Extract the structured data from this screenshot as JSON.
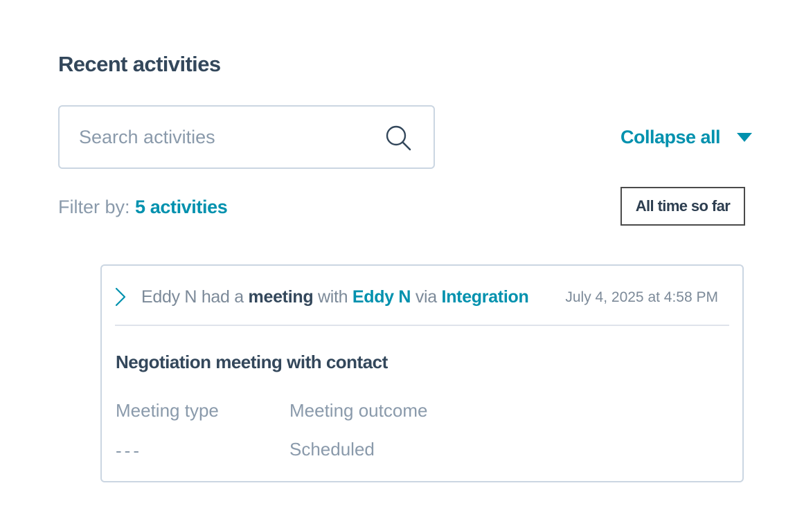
{
  "header": {
    "title": "Recent activities"
  },
  "search": {
    "placeholder": "Search activities",
    "value": ""
  },
  "toolbar": {
    "collapse_label": "Collapse all",
    "filter_prefix": "Filter by: ",
    "filter_link": "5 activities",
    "time_range": "All time so far"
  },
  "activity": {
    "actor": "Eddy N",
    "text_had": " had a ",
    "type": "meeting",
    "text_with": " with ",
    "contact": "Eddy N",
    "text_via": " via ",
    "source": "Integration",
    "timestamp": "July 4, 2025 at 4:58 PM",
    "title": "Negotiation meeting with contact",
    "fields": {
      "meeting_type_label": "Meeting type",
      "meeting_type_value": "---",
      "meeting_outcome_label": "Meeting outcome",
      "meeting_outcome_value": "Scheduled"
    }
  },
  "colors": {
    "accent": "#0091ae",
    "heading": "#33475b",
    "muted": "#8a9aab",
    "border": "#cbd6e2"
  },
  "icons": {
    "search": "search-icon",
    "collapse": "caret-down-icon",
    "expand_row": "chevron-right-icon"
  }
}
